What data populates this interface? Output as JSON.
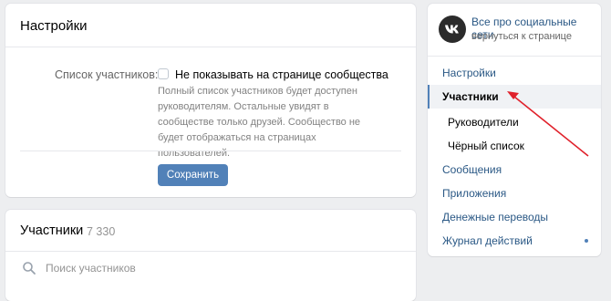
{
  "settings": {
    "title": "Настройки",
    "members_label": "Список участников:",
    "hide_checkbox_label": "Не показывать на странице сообщества",
    "hide_checked": false,
    "hint": "Полный список участников будет доступен руководителям. Остальные увидят в сообществе только друзей. Сообщество не будет отображаться на страницах пользователей.",
    "save_label": "Сохранить"
  },
  "members": {
    "title": "Участники",
    "count": "7 330",
    "search_placeholder": "Поиск участников"
  },
  "sidebar": {
    "group_name": "Все про социальные сети",
    "back_link": "вернуться к странице",
    "avatar_text": "ᴠᴋ",
    "items": [
      {
        "label": "Настройки",
        "active": false,
        "sub": false
      },
      {
        "label": "Участники",
        "active": true,
        "sub": false
      },
      {
        "label": "Руководители",
        "active": false,
        "sub": true
      },
      {
        "label": "Чёрный список",
        "active": false,
        "sub": true
      },
      {
        "label": "Сообщения",
        "active": false,
        "sub": false
      },
      {
        "label": "Приложения",
        "active": false,
        "sub": false
      },
      {
        "label": "Денежные переводы",
        "active": false,
        "sub": false
      },
      {
        "label": "Журнал действий",
        "active": false,
        "sub": false,
        "dot": true
      }
    ]
  },
  "colors": {
    "accent": "#5181b8",
    "link": "#2a5885",
    "annotation_arrow": "#e0212b"
  }
}
